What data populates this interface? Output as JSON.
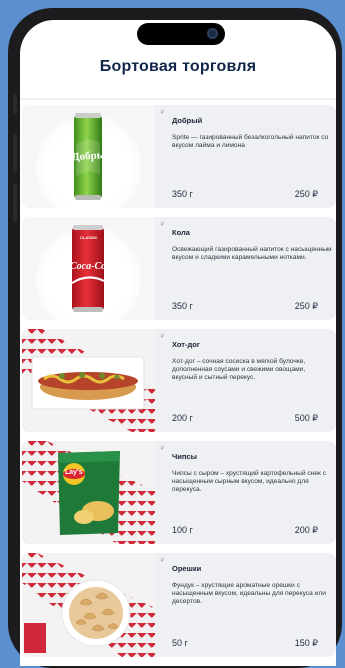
{
  "header": {
    "title": "Бортовая торговля"
  },
  "products": [
    {
      "name": "Добрый",
      "description": "Sprite — газированный безалкогольный напиток со вкусом лайма и лимона",
      "weight": "350 г",
      "price": "250 ₽",
      "can_text": "Добрый",
      "image": "green-soda-can"
    },
    {
      "name": "Кола",
      "description": "Освежающий газированный напиток с насыщенным вкусом и сладкими карамельными нотками.",
      "weight": "350 г",
      "price": "250 ₽",
      "can_text": "Coca-Cola",
      "can_subtext": "CLASSIC",
      "image": "cola-can"
    },
    {
      "name": "Хот-дог",
      "description": "Хот-дог – сочная сосиска в мягкой булочке, дополненная соусами и свежими овощами, вкусный и сытный перекус.",
      "weight": "200 г",
      "price": "500 ₽",
      "image": "hot-dog"
    },
    {
      "name": "Чипсы",
      "description": "Чипсы с сыром – хрустящий картофельный снек с насыщенным сырным вкусом, идеально для перекуса.",
      "weight": "100 г",
      "price": "200 ₽",
      "bag_text": "Lay's",
      "image": "chips-bag"
    },
    {
      "name": "Орешки",
      "description": "Фундук – хрустящие ароматные орешки с насыщенным вкусом, идеальны для перекуса или десертов.",
      "weight": "50 г",
      "price": "150 ₽",
      "image": "nuts-bowl"
    }
  ],
  "colors": {
    "accent": "#12274a",
    "card_bg": "#eef0f3",
    "brand_red": "#cf2b3a",
    "page_bg": "#5b8fd0"
  }
}
